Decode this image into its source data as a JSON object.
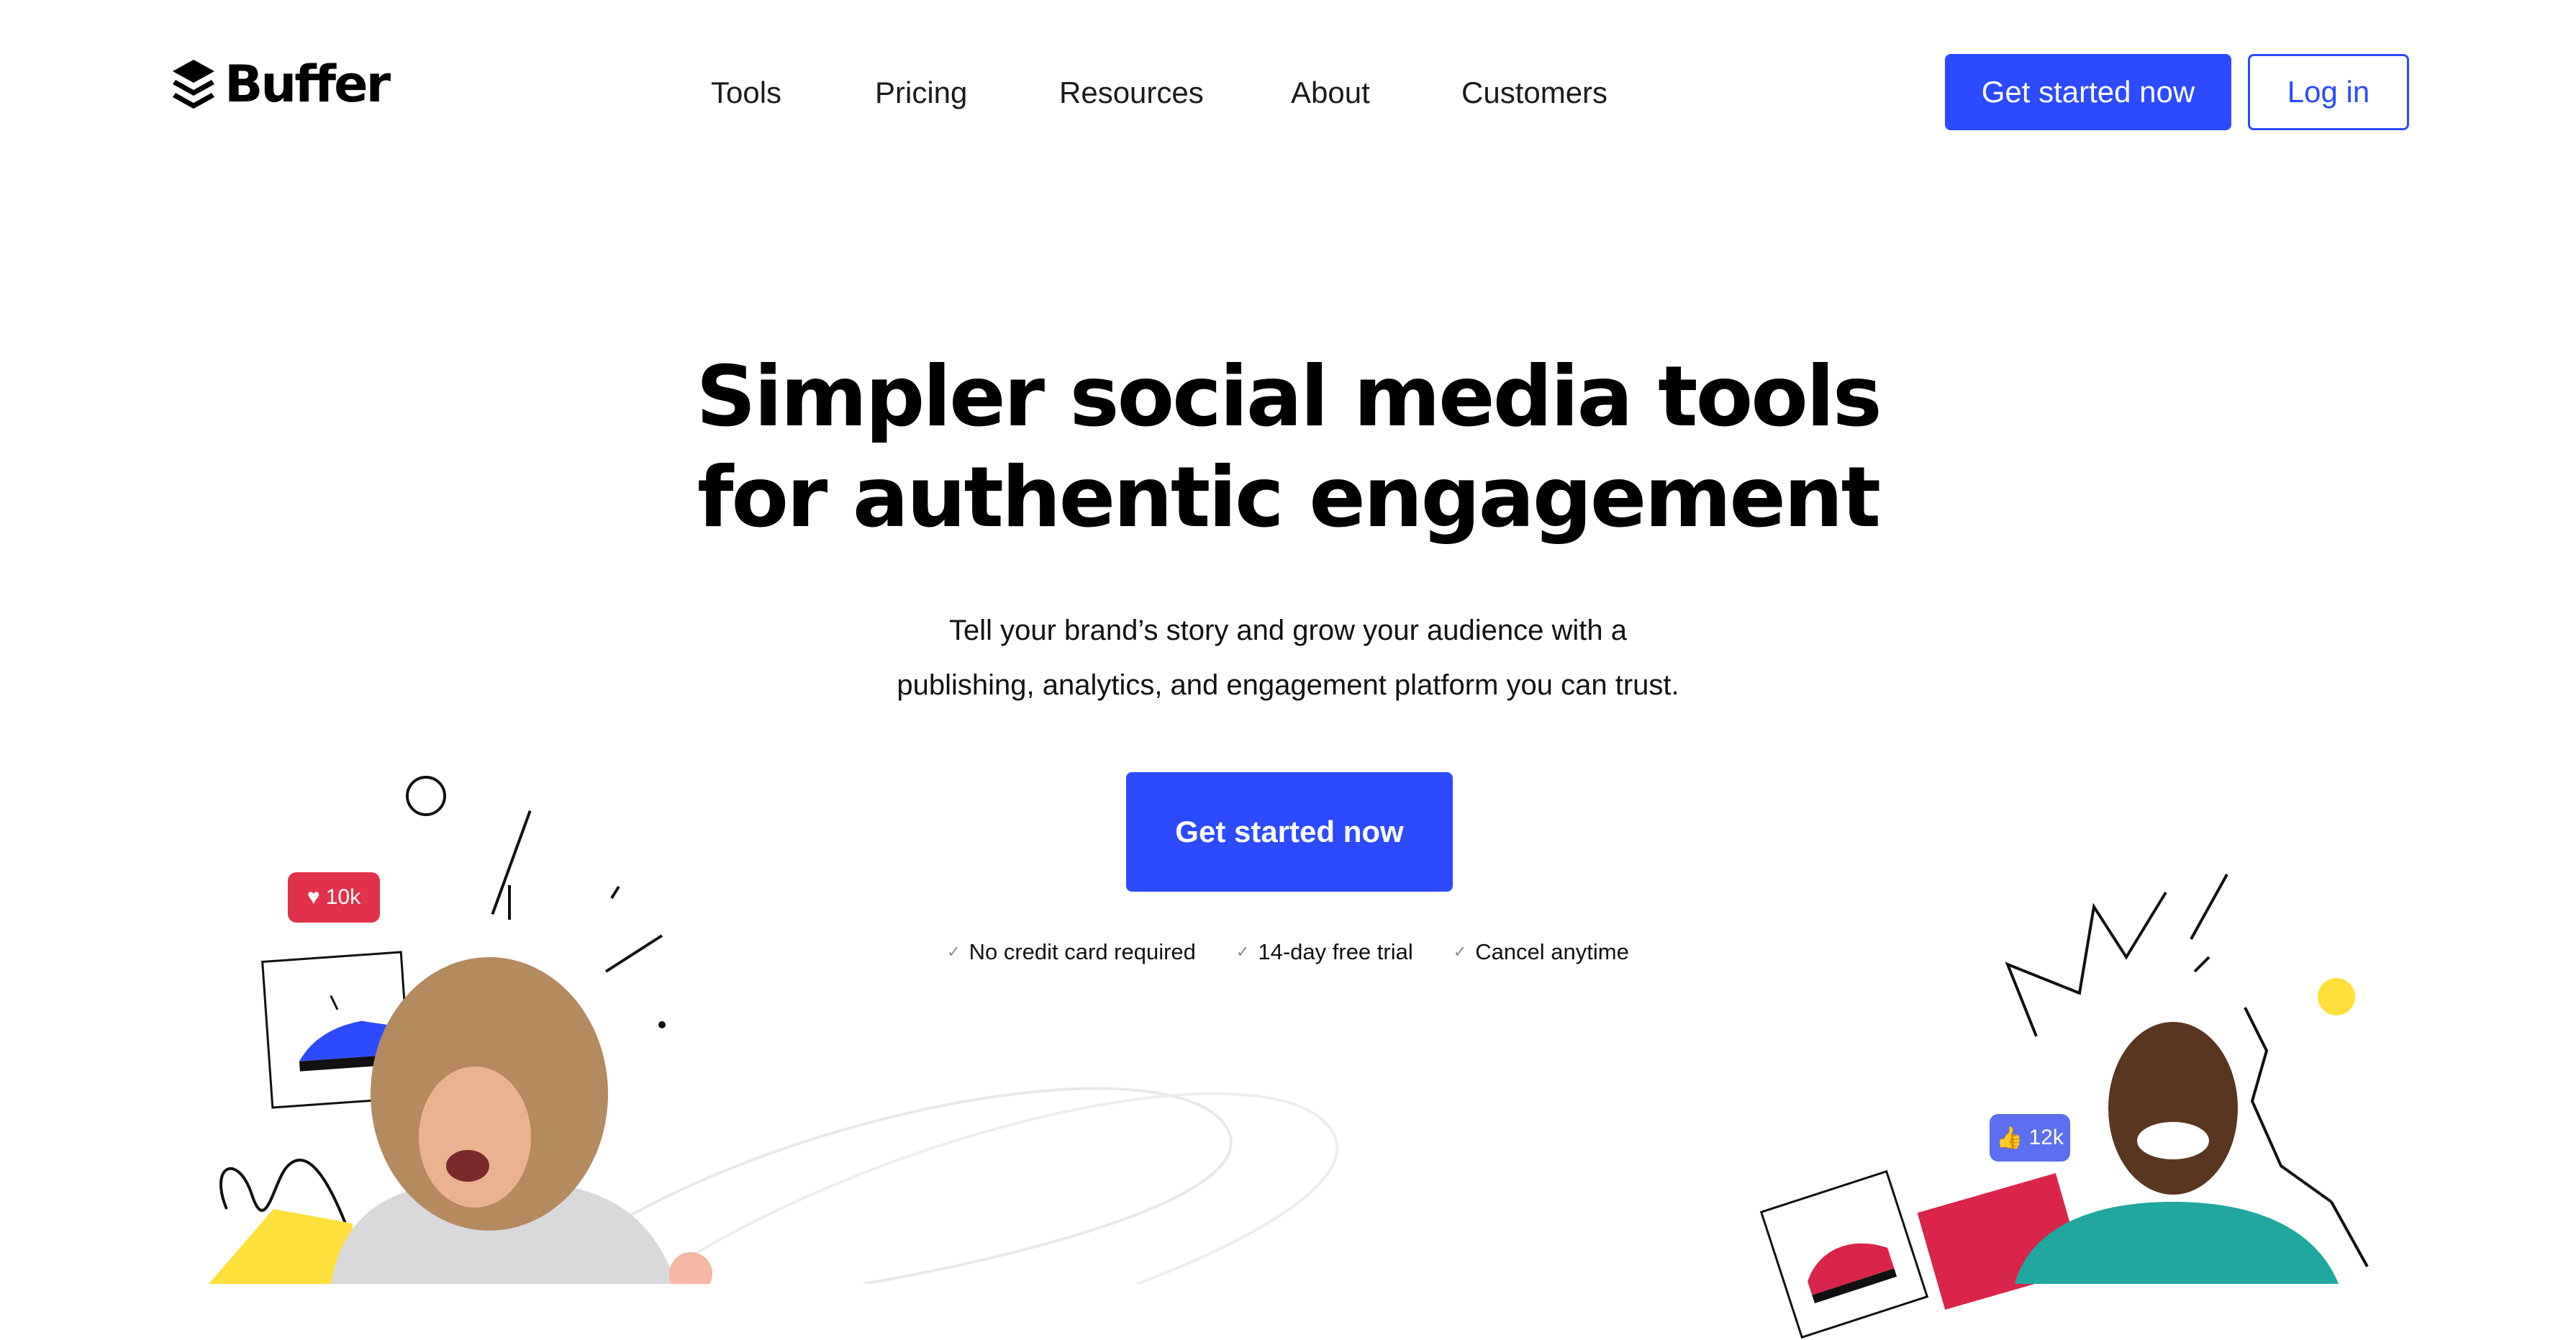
{
  "brand": {
    "name": "Buffer"
  },
  "nav": {
    "items": [
      {
        "label": "Tools"
      },
      {
        "label": "Pricing"
      },
      {
        "label": "Resources"
      },
      {
        "label": "About"
      },
      {
        "label": "Customers"
      }
    ]
  },
  "header": {
    "cta_label": "Get started now",
    "login_label": "Log in"
  },
  "hero": {
    "title_line1": "Simpler social media tools",
    "title_line2": "for authentic engagement",
    "subtitle_line1": "Tell your brand’s story and grow your audience with a",
    "subtitle_line2": "publishing, analytics, and engagement platform you can trust.",
    "cta_label": "Get started now",
    "perks": [
      {
        "label": "No credit card required"
      },
      {
        "label": "14-day free trial"
      },
      {
        "label": "Cancel anytime"
      }
    ]
  },
  "illustration": {
    "likes_badge": "10k",
    "thumbs_badge": "12k"
  },
  "colors": {
    "primary": "#2c4bff",
    "heart_badge": "#e0334b",
    "thumbs_badge": "#5b6ff0",
    "accent_yellow": "#ffe03a",
    "accent_red": "#d9254a"
  },
  "icons": {
    "logo": "stacked-layers-icon",
    "check": "check-icon",
    "heart": "heart-icon",
    "thumbs": "thumbs-up-icon"
  }
}
